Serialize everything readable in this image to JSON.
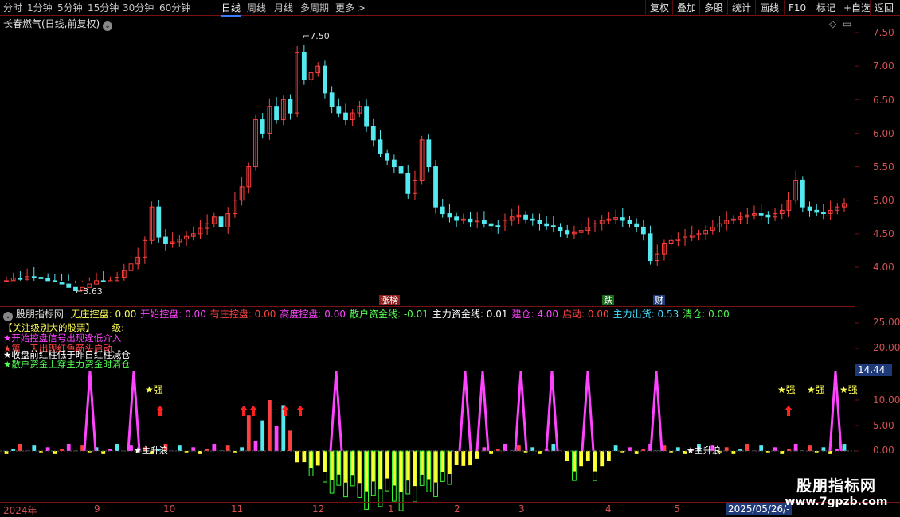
{
  "toolbar": {
    "periods": [
      "分时",
      "1分钟",
      "5分钟",
      "15分钟",
      "30分钟",
      "60分钟",
      "日线",
      "周线",
      "月线",
      "多周期",
      "更多 >"
    ],
    "active_period": "日线",
    "actions": [
      "复权",
      "叠加",
      "多股",
      "统计",
      "画线",
      "F10",
      "标记",
      "+自选",
      "返回"
    ]
  },
  "main_chart": {
    "title": "长春燃气(日线,前复权)",
    "high_label": "7.50",
    "low_label": "3.63",
    "tags": {
      "zhang": "涨榜",
      "die": "跌",
      "cai": "财"
    },
    "y_ticks": [
      "7.50",
      "7.00",
      "6.50",
      "6.00",
      "5.50",
      "5.00",
      "4.50",
      "4.00"
    ]
  },
  "indicator": {
    "name": "股朋指标网",
    "fields": [
      {
        "label": "无庄控盘:",
        "value": "0.00",
        "color": "#ffff55"
      },
      {
        "label": "开始控盘:",
        "value": "0.00",
        "color": "#ff44ff"
      },
      {
        "label": "有庄控盘:",
        "value": "0.00",
        "color": "#ff4444"
      },
      {
        "label": "高度控盘:",
        "value": "0.00",
        "color": "#ff44ff"
      },
      {
        "label": "散户资金线:",
        "value": "-0.01",
        "color": "#55ff55"
      },
      {
        "label": "主力资金线:",
        "value": "0.01",
        "color": "#ffffff"
      },
      {
        "label": "建仓:",
        "value": "4.00",
        "color": "#ff44ff"
      },
      {
        "label": "启动:",
        "value": "0.00",
        "color": "#ff4444"
      },
      {
        "label": "主力出货:",
        "value": "0.53",
        "color": "#44ddff"
      },
      {
        "label": "清仓:",
        "value": "0.00",
        "color": "#55ff55"
      }
    ],
    "legend": [
      {
        "text": "【关注级别大的股票】",
        "color": "#ffff55"
      },
      {
        "text": "级:",
        "color": "#ffff55"
      },
      {
        "text": "★开始控盘信号出现逢低介入",
        "color": "#ff44ff"
      },
      {
        "text": "★第一天出现红色箭头启动",
        "color": "#ff4444"
      },
      {
        "text": "★收盘前红柱低于昨日红柱减仓",
        "color": "#ffffff"
      },
      {
        "text": "★散户资金上穿主力资金时清仓",
        "color": "#55ff55"
      }
    ],
    "y_ticks": [
      "25.00",
      "20.00",
      "15.00",
      "10.00",
      "5.00",
      "0.00"
    ],
    "cursor_value": "14.44",
    "strong_label": "★强",
    "rise_label": "★主升浪"
  },
  "time_axis": {
    "labels": [
      "2024年",
      "9",
      "10",
      "11",
      "12",
      "1",
      "2",
      "3",
      "4",
      "5"
    ],
    "cursor_date": "2025/05/26/-"
  },
  "watermark": {
    "title": "股朋指标网",
    "url": "www.7gpzb.com"
  },
  "chart_data": {
    "type": "candlestick",
    "title": "长春燃气(日线,前复权)",
    "ylim": [
      3.8,
      7.6
    ],
    "x": [
      "2024年",
      "9",
      "10",
      "11",
      "12",
      "1",
      "2",
      "3",
      "4",
      "5"
    ],
    "closes": [
      3.8,
      3.84,
      3.82,
      3.86,
      3.85,
      3.83,
      3.8,
      3.78,
      3.75,
      3.7,
      3.65,
      3.7,
      3.75,
      3.8,
      3.78,
      3.8,
      3.85,
      3.95,
      4.05,
      4.15,
      4.4,
      4.9,
      4.45,
      4.35,
      4.38,
      4.42,
      4.46,
      4.5,
      4.58,
      4.65,
      4.75,
      4.6,
      4.8,
      5.0,
      5.2,
      5.5,
      6.2,
      6.0,
      6.4,
      6.2,
      6.5,
      6.3,
      7.2,
      6.8,
      6.9,
      7.0,
      6.6,
      6.4,
      6.3,
      6.2,
      6.3,
      6.4,
      6.1,
      5.9,
      5.7,
      5.6,
      5.5,
      5.4,
      5.1,
      5.3,
      5.9,
      5.5,
      4.9,
      4.8,
      4.75,
      4.7,
      4.72,
      4.68,
      4.7,
      4.65,
      4.62,
      4.6,
      4.7,
      4.75,
      4.78,
      4.72,
      4.7,
      4.65,
      4.62,
      4.6,
      4.55,
      4.5,
      4.52,
      4.55,
      4.6,
      4.65,
      4.7,
      4.72,
      4.74,
      4.7,
      4.65,
      4.6,
      4.5,
      4.1,
      4.2,
      4.35,
      4.4,
      4.42,
      4.45,
      4.48,
      4.5,
      4.55,
      4.6,
      4.65,
      4.7,
      4.72,
      4.75,
      4.78,
      4.8,
      4.78,
      4.75,
      4.8,
      4.85,
      5.0,
      5.3,
      4.9,
      4.85,
      4.82,
      4.8,
      4.85,
      4.9,
      4.95
    ],
    "indicator_series": [
      {
        "name": "高度控盘",
        "peaks": [
          14,
          14,
          14,
          14,
          14,
          14,
          14,
          14,
          14,
          14,
          14
        ]
      },
      {
        "name": "散户资金线"
      },
      {
        "name": "主力资金线"
      }
    ]
  }
}
